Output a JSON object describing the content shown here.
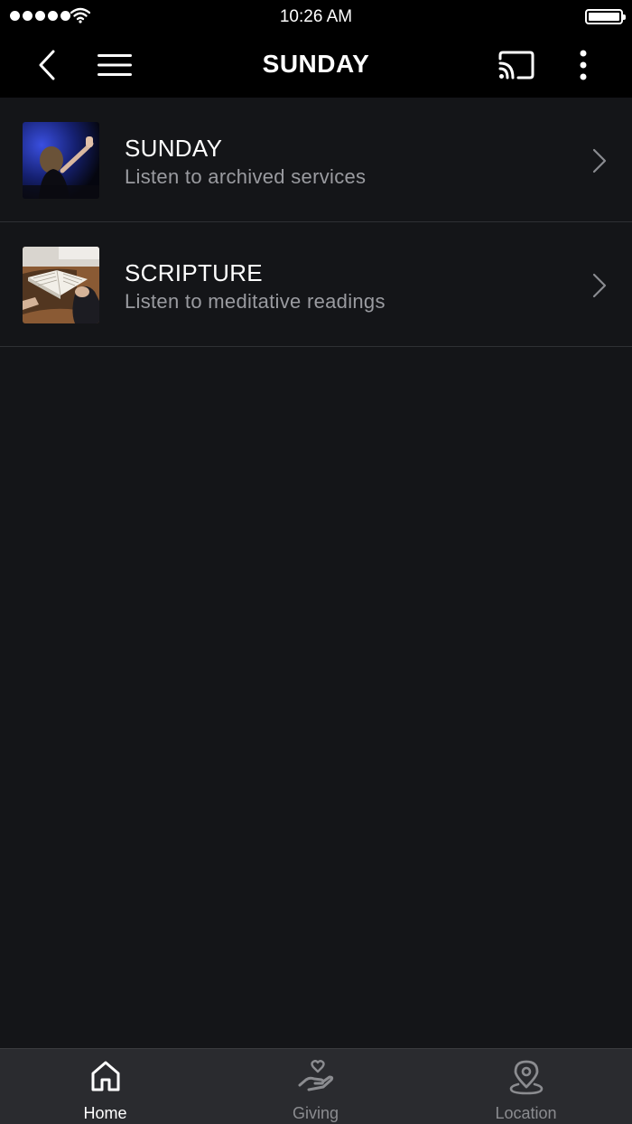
{
  "status_bar": {
    "time": "10:26 AM"
  },
  "nav": {
    "title": "SUNDAY"
  },
  "list": {
    "items": [
      {
        "title": "SUNDAY",
        "subtitle": "Listen to archived services"
      },
      {
        "title": "SCRIPTURE",
        "subtitle": "Listen to meditative readings"
      }
    ]
  },
  "tabs": [
    {
      "label": "Home",
      "icon": "home-icon",
      "active": true
    },
    {
      "label": "Giving",
      "icon": "giving-icon",
      "active": false
    },
    {
      "label": "Location",
      "icon": "location-pin-icon",
      "active": false
    }
  ],
  "colors": {
    "background": "#141518",
    "bar": "#000000",
    "tab_bar": "#2a2b2f",
    "subtitle": "#9a9ba0",
    "inactive_tab": "#8b8c90"
  }
}
